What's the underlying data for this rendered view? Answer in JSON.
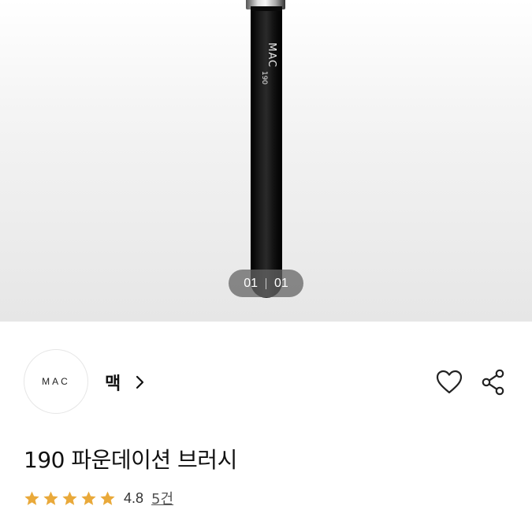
{
  "hero": {
    "brush_brand_text": "MAC",
    "brush_number": "190",
    "pager": {
      "current": "01",
      "total": "01"
    }
  },
  "brand": {
    "logo_text": "MAC",
    "name": "맥",
    "chevron_icon": "chevron-right-icon",
    "wishlist_icon": "heart-outline-icon",
    "share_icon": "share-icon"
  },
  "product": {
    "title": "190 파운데이션 브러시",
    "rating": "4.8",
    "rating_stars": 5,
    "review_count": "5건",
    "star_color": "#E9A93A"
  }
}
